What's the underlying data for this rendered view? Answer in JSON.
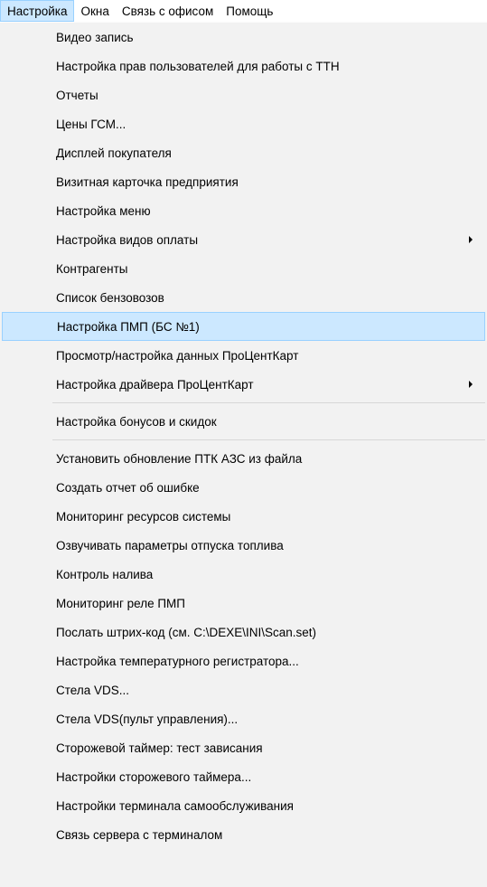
{
  "menubar": {
    "items": [
      {
        "label": "Настройка",
        "active": true
      },
      {
        "label": "Окна",
        "active": false
      },
      {
        "label": "Связь с офисом",
        "active": false
      },
      {
        "label": "Помощь",
        "active": false
      }
    ]
  },
  "dropdown": {
    "highlight_color": "#cce8ff",
    "items": [
      {
        "label": "Видео запись"
      },
      {
        "label": "Настройка прав пользователей для работы с ТТН"
      },
      {
        "label": "Отчеты"
      },
      {
        "label": "Цены ГСМ..."
      },
      {
        "label": "Дисплей покупателя"
      },
      {
        "label": "Визитная карточка предприятия"
      },
      {
        "label": "Настройка меню"
      },
      {
        "label": "Настройка видов оплаты",
        "submenu": true
      },
      {
        "label": "Контрагенты"
      },
      {
        "label": "Список бензовозов"
      },
      {
        "label": "Настройка ПМП (БС №1)",
        "highlighted": true
      },
      {
        "label": "Просмотр/настройка данных ПроЦентКарт"
      },
      {
        "label": "Настройка драйвера ПроЦентКарт",
        "submenu": true
      },
      {
        "separator": true
      },
      {
        "label": "Настройка бонусов и скидок"
      },
      {
        "separator": true
      },
      {
        "label": "Установить обновление ПТК АЗС из файла"
      },
      {
        "label": "Создать отчет об ошибке"
      },
      {
        "label": "Мониторинг ресурсов системы"
      },
      {
        "label": "Озвучивать параметры отпуска топлива"
      },
      {
        "label": "Контроль налива"
      },
      {
        "label": "Мониторинг реле ПМП"
      },
      {
        "label": "Послать штрих-код (см. C:\\DEXE\\INI\\Scan.set)"
      },
      {
        "label": "Настройка температурного регистратора..."
      },
      {
        "label": "Стела VDS..."
      },
      {
        "label": "Стела VDS(пульт управления)..."
      },
      {
        "label": "Сторожевой таймер: тест зависания"
      },
      {
        "label": "Настройки сторожевого таймера..."
      },
      {
        "label": "Настройки терминала самообслуживания"
      },
      {
        "label": "Связь сервера с терминалом"
      }
    ]
  }
}
